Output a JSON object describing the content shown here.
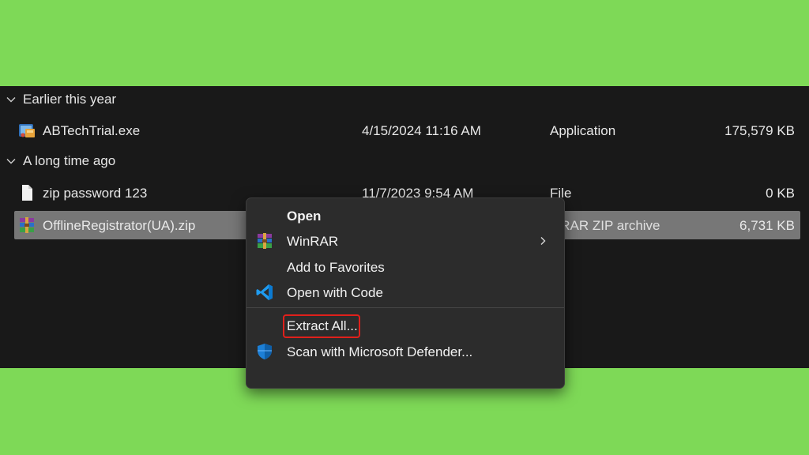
{
  "groups": [
    {
      "label": "Earlier this year",
      "files": [
        {
          "name": "ABTechTrial.exe",
          "date": "4/15/2024 11:16 AM",
          "type": "Application",
          "size": "175,579 KB",
          "icon": "installer-icon"
        }
      ]
    },
    {
      "label": "A long time ago",
      "files": [
        {
          "name": "zip password 123",
          "date": "11/7/2023 9:54 AM",
          "type": "File",
          "size": "0 KB",
          "icon": "file-icon"
        },
        {
          "name": "OfflineRegistrator(UA).zip",
          "date": "",
          "type": "inRAR ZIP archive",
          "size": "6,731 KB",
          "icon": "winrar-archive-icon",
          "selected": true
        }
      ]
    }
  ],
  "context_menu": {
    "items": [
      {
        "label": "Open",
        "icon": "",
        "bold": true
      },
      {
        "label": "WinRAR",
        "icon": "winrar-icon",
        "submenu": true
      },
      {
        "label": "Add to Favorites",
        "icon": ""
      },
      {
        "label": "Open with Code",
        "icon": "vscode-icon"
      },
      {
        "label": "Extract All...",
        "icon": "",
        "highlighted": true
      },
      {
        "label": "Scan with Microsoft Defender...",
        "icon": "defender-shield-icon"
      }
    ]
  },
  "colors": {
    "background": "#7ed957",
    "explorer_bg": "#191919",
    "menu_bg": "#2c2c2c",
    "selection": "#777777",
    "highlight_border": "#e0201b"
  }
}
